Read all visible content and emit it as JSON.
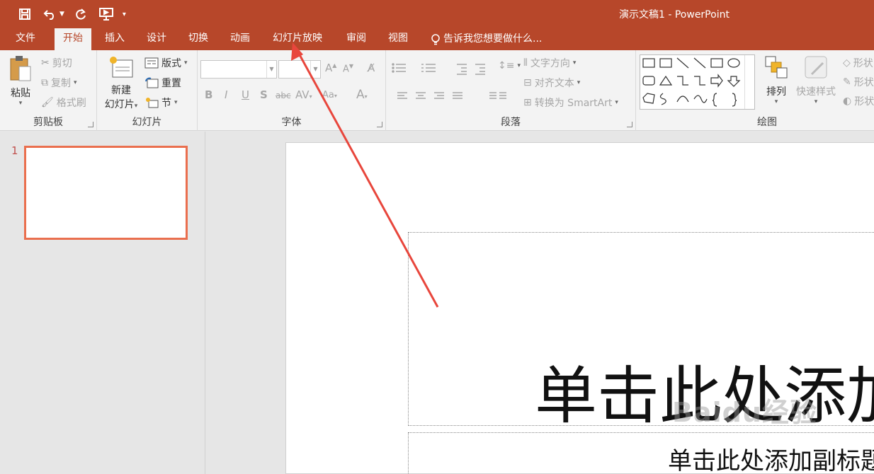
{
  "window": {
    "title": "演示文稿1 - PowerPoint"
  },
  "colors": {
    "accent": "#b7472a",
    "thumb_border": "#ea6f4e",
    "annotation_arrow": "#e8463c"
  },
  "quick_access": {
    "icons": [
      "save-icon",
      "undo-icon",
      "redo-icon",
      "start-from-beginning-icon",
      "customize-qat-icon"
    ]
  },
  "tabs": [
    {
      "label": "文件"
    },
    {
      "label": "开始",
      "active": true
    },
    {
      "label": "插入"
    },
    {
      "label": "设计"
    },
    {
      "label": "切换"
    },
    {
      "label": "动画"
    },
    {
      "label": "幻灯片放映"
    },
    {
      "label": "审阅"
    },
    {
      "label": "视图"
    }
  ],
  "tell_me": "告诉我您想要做什么...",
  "ribbon": {
    "clipboard": {
      "label": "剪贴板",
      "paste": "粘贴",
      "cut": "剪切",
      "copy": "复制",
      "format_painter": "格式刷"
    },
    "slides": {
      "label": "幻灯片",
      "new_slide_line1": "新建",
      "new_slide_line2": "幻灯片",
      "layout": "版式",
      "reset": "重置",
      "section": "节"
    },
    "font": {
      "label": "字体",
      "font_name": "",
      "font_size": ""
    },
    "paragraph": {
      "label": "段落",
      "text_direction": "文字方向",
      "align_text": "对齐文本",
      "smartart": "转换为 SmartArt"
    },
    "drawing": {
      "label": "绘图",
      "arrange": "排列",
      "quick_styles": "快速样式",
      "shape_fill": "形状",
      "shape_outline": "形状",
      "shape_effects": "形状"
    }
  },
  "slides_pane": {
    "slide_number": "1"
  },
  "slide": {
    "title_placeholder": "单击此处添加",
    "subtitle_placeholder": "单击此处添加副标题"
  },
  "watermark": "Baidu经验"
}
